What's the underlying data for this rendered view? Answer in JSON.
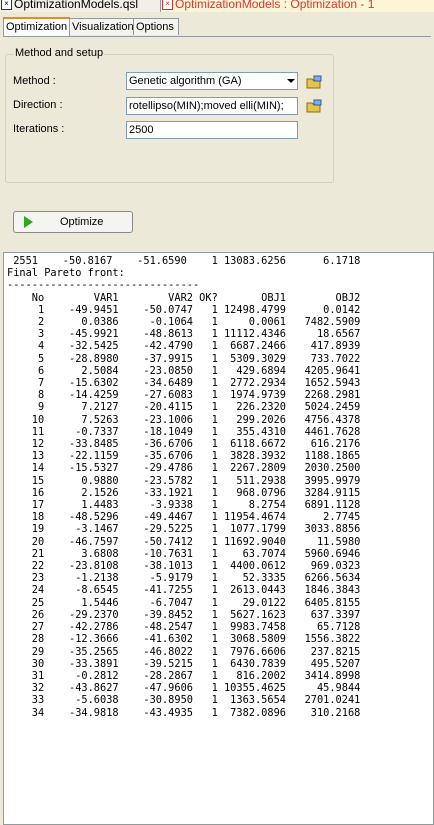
{
  "doc_tabs": [
    {
      "label": "OptimizationModels.qsl"
    },
    {
      "label": "OptimizationModels : Optimization - 1"
    }
  ],
  "sub_tabs": [
    {
      "label": "Optimization",
      "active": true
    },
    {
      "label": "Visualization",
      "active": false
    },
    {
      "label": "Options",
      "active": false
    }
  ],
  "setup": {
    "title": "Method and setup",
    "method_label": "Method :",
    "method_value": "Genetic algorithm (GA)",
    "direction_label": "Direction :",
    "direction_value": "rotellipso(MIN);moved elli(MIN);",
    "iterations_label": "Iterations :",
    "iterations_value": "2500"
  },
  "optimize_label": "Optimize",
  "colors": {
    "accent_tab": "#e68b2c",
    "play": "#2fa71d",
    "doc_tab_active_text": "#dd3333"
  },
  "output": {
    "pre_line": " 2551    -50.8167    -51.6590    1 13083.6256      6.1718",
    "heading": "Final Pareto front:",
    "separator": "-------------------------------",
    "columns": [
      "No",
      "VAR1",
      "VAR2",
      "OK?",
      "OBJ1",
      "OBJ2"
    ],
    "rows": [
      [
        "1",
        "-49.9451",
        "-50.0747",
        "1",
        "12498.4799",
        "0.0142"
      ],
      [
        "2",
        "0.0386",
        "-0.1064",
        "1",
        "0.0061",
        "7482.5909"
      ],
      [
        "3",
        "-45.9921",
        "-48.8613",
        "1",
        "11112.4346",
        "18.6567"
      ],
      [
        "4",
        "-32.5425",
        "-42.4790",
        "1",
        "6687.2466",
        "417.8939"
      ],
      [
        "5",
        "-28.8980",
        "-37.9915",
        "1",
        "5309.3029",
        "733.7022"
      ],
      [
        "6",
        "2.5084",
        "-23.0850",
        "1",
        "429.6894",
        "4205.9641"
      ],
      [
        "7",
        "-15.6302",
        "-34.6489",
        "1",
        "2772.2934",
        "1652.5943"
      ],
      [
        "8",
        "-14.4259",
        "-27.6083",
        "1",
        "1974.9739",
        "2268.2981"
      ],
      [
        "9",
        "7.2127",
        "-20.4115",
        "1",
        "226.2320",
        "5024.2459"
      ],
      [
        "10",
        "7.5263",
        "-23.1006",
        "1",
        "299.2026",
        "4756.4378"
      ],
      [
        "11",
        "-0.7337",
        "-18.1049",
        "1",
        "355.4310",
        "4461.7628"
      ],
      [
        "12",
        "-33.8485",
        "-36.6706",
        "1",
        "6118.6672",
        "616.2176"
      ],
      [
        "13",
        "-22.1159",
        "-35.6706",
        "1",
        "3828.3932",
        "1188.1865"
      ],
      [
        "14",
        "-15.5327",
        "-29.4786",
        "1",
        "2267.2809",
        "2030.2500"
      ],
      [
        "15",
        "0.9880",
        "-23.5782",
        "1",
        "511.2938",
        "3995.9979"
      ],
      [
        "16",
        "2.1526",
        "-33.1921",
        "1",
        "968.0796",
        "3284.9115"
      ],
      [
        "17",
        "1.4483",
        "-3.9338",
        "1",
        "8.2754",
        "6891.1128"
      ],
      [
        "18",
        "-48.5296",
        "-49.4467",
        "1",
        "11954.4674",
        "2.7745"
      ],
      [
        "19",
        "-3.1467",
        "-29.5225",
        "1",
        "1077.1799",
        "3033.8856"
      ],
      [
        "20",
        "-46.7597",
        "-50.7412",
        "1",
        "11692.9040",
        "11.5980"
      ],
      [
        "21",
        "3.6808",
        "-10.7631",
        "1",
        "63.7074",
        "5960.6946"
      ],
      [
        "22",
        "-23.8108",
        "-38.1013",
        "1",
        "4400.0612",
        "969.0323"
      ],
      [
        "23",
        "-1.2138",
        "-5.9179",
        "1",
        "52.3335",
        "6266.5634"
      ],
      [
        "24",
        "-8.6545",
        "-41.7255",
        "1",
        "2613.0443",
        "1846.3843"
      ],
      [
        "25",
        "1.5446",
        "-6.7047",
        "1",
        "29.0122",
        "6405.8155"
      ],
      [
        "26",
        "-29.2370",
        "-39.8452",
        "1",
        "5627.1623",
        "637.3397"
      ],
      [
        "27",
        "-42.2786",
        "-48.2547",
        "1",
        "9983.7458",
        "65.7128"
      ],
      [
        "28",
        "-12.3666",
        "-41.6302",
        "1",
        "3068.5809",
        "1556.3822"
      ],
      [
        "29",
        "-35.2565",
        "-46.8022",
        "1",
        "7976.6606",
        "237.8215"
      ],
      [
        "30",
        "-33.3891",
        "-39.5215",
        "1",
        "6430.7839",
        "495.5207"
      ],
      [
        "31",
        "-0.2812",
        "-28.2867",
        "1",
        "816.2002",
        "3414.8998"
      ],
      [
        "32",
        "-43.8627",
        "-47.9606",
        "1",
        "10355.4625",
        "45.9844"
      ],
      [
        "33",
        "-5.6038",
        "-30.8950",
        "1",
        "1363.5654",
        "2701.0241"
      ],
      [
        "34",
        "-34.9818",
        "-43.4935",
        "1",
        "7382.0896",
        "310.2168"
      ]
    ]
  }
}
